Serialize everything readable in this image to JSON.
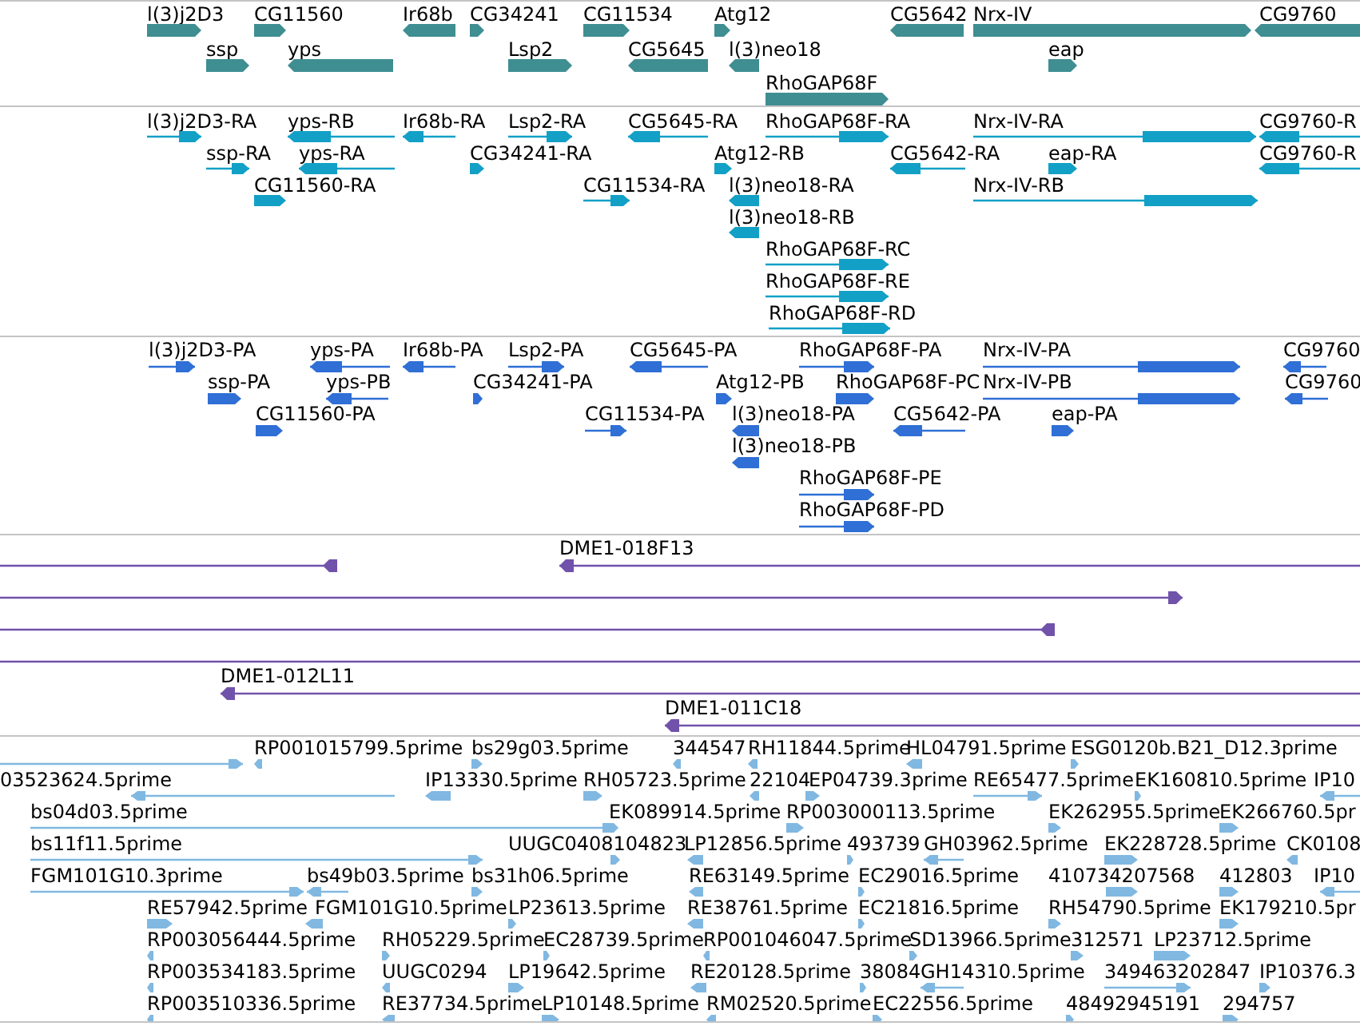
{
  "tracks": [
    {
      "kind": "gene",
      "rows": [
        {
          "features": [
            {
              "label": "l(3)j2D3",
              "reverse": false
            },
            {
              "label": "CG11560",
              "reverse": false
            },
            {
              "label": "Ir68b",
              "reverse": true
            },
            {
              "label": "CG34241",
              "reverse": false
            },
            {
              "label": "CG11534",
              "reverse": false
            },
            {
              "label": "Atg12",
              "reverse": false
            },
            {
              "label": "CG5642",
              "reverse": true
            },
            {
              "label": "Nrx-IV",
              "reverse": false
            },
            {
              "label": "CG9760",
              "reverse": true
            }
          ]
        },
        {
          "features": [
            {
              "label": "ssp",
              "reverse": false
            },
            {
              "label": "yps",
              "reverse": true
            },
            {
              "label": "Lsp2",
              "reverse": false
            },
            {
              "label": "CG5645",
              "reverse": true
            },
            {
              "label": "l(3)neo18",
              "reverse": true
            },
            {
              "label": "eap",
              "reverse": false
            }
          ]
        },
        {
          "features": [
            {
              "label": "RhoGAP68F",
              "reverse": false
            }
          ]
        }
      ]
    },
    {
      "kind": "transcript",
      "rows": [
        {
          "features": [
            {
              "label": "l(3)j2D3-RA",
              "reverse": false
            },
            {
              "label": "yps-RB",
              "reverse": true
            },
            {
              "label": "Ir68b-RA",
              "reverse": true
            },
            {
              "label": "Lsp2-RA",
              "reverse": false
            },
            {
              "label": "CG5645-RA",
              "reverse": true
            },
            {
              "label": "RhoGAP68F-RA",
              "reverse": false
            },
            {
              "label": "Nrx-IV-RA",
              "reverse": false
            },
            {
              "label": "CG9760-R",
              "reverse": true
            }
          ]
        },
        {
          "features": [
            {
              "label": "ssp-RA",
              "reverse": false
            },
            {
              "label": "yps-RA",
              "reverse": true
            },
            {
              "label": "CG34241-RA",
              "reverse": false
            },
            {
              "label": "Atg12-RB",
              "reverse": false
            },
            {
              "label": "CG5642-RA",
              "reverse": true
            },
            {
              "label": "eap-RA",
              "reverse": false
            },
            {
              "label": "CG9760-R",
              "reverse": true
            }
          ]
        },
        {
          "features": [
            {
              "label": "CG11560-RA",
              "reverse": false
            },
            {
              "label": "CG11534-RA",
              "reverse": false
            },
            {
              "label": "l(3)neo18-RA",
              "reverse": true
            },
            {
              "label": "Nrx-IV-RB",
              "reverse": false
            }
          ]
        },
        {
          "features": [
            {
              "label": "l(3)neo18-RB",
              "reverse": true
            }
          ]
        },
        {
          "features": [
            {
              "label": "RhoGAP68F-RC",
              "reverse": false
            }
          ]
        },
        {
          "features": [
            {
              "label": "RhoGAP68F-RE",
              "reverse": false
            }
          ]
        },
        {
          "features": [
            {
              "label": "RhoGAP68F-RD",
              "reverse": false
            }
          ]
        }
      ]
    },
    {
      "kind": "protein",
      "rows": [
        {
          "features": [
            {
              "label": "l(3)j2D3-PA",
              "reverse": false
            },
            {
              "label": "yps-PA",
              "reverse": true
            },
            {
              "label": "Ir68b-PA",
              "reverse": true
            },
            {
              "label": "Lsp2-PA",
              "reverse": false
            },
            {
              "label": "CG5645-PA",
              "reverse": true
            },
            {
              "label": "RhoGAP68F-PA",
              "reverse": false
            },
            {
              "label": "Nrx-IV-PA",
              "reverse": false
            },
            {
              "label": "CG9760",
              "reverse": true
            }
          ]
        },
        {
          "features": [
            {
              "label": "ssp-PA",
              "reverse": false
            },
            {
              "label": "yps-PB",
              "reverse": true
            },
            {
              "label": "CG34241-PA",
              "reverse": false
            },
            {
              "label": "Atg12-PB",
              "reverse": false
            },
            {
              "label": "RhoGAP68F-PC",
              "reverse": false
            },
            {
              "label": "Nrx-IV-PB",
              "reverse": false
            },
            {
              "label": "CG9760",
              "reverse": true
            }
          ]
        },
        {
          "features": [
            {
              "label": "CG11560-PA",
              "reverse": false
            },
            {
              "label": "CG11534-PA",
              "reverse": false
            },
            {
              "label": "l(3)neo18-PA",
              "reverse": true
            },
            {
              "label": "CG5642-PA",
              "reverse": true
            },
            {
              "label": "eap-PA",
              "reverse": false
            }
          ]
        },
        {
          "features": [
            {
              "label": "l(3)neo18-PB",
              "reverse": true
            }
          ]
        },
        {
          "features": [
            {
              "label": "RhoGAP68F-PE",
              "reverse": false
            }
          ]
        },
        {
          "features": [
            {
              "label": "RhoGAP68F-PD",
              "reverse": false
            }
          ]
        }
      ]
    },
    {
      "kind": "clone",
      "rows": [
        {
          "features": [
            {
              "reverse": true
            },
            {
              "label": "DME1-018F13",
              "reverse": true
            }
          ]
        },
        {
          "features": [
            {
              "reverse": false
            }
          ]
        },
        {
          "features": [
            {
              "reverse": true
            }
          ]
        },
        {
          "features": [
            {
              "truncated": true
            }
          ]
        },
        {
          "features": [
            {
              "label": "DME1-012L11",
              "reverse": true
            }
          ]
        },
        {
          "features": [
            {
              "label": "DME1-011C18",
              "reverse": true
            }
          ]
        }
      ]
    },
    {
      "kind": "est",
      "rows": [
        {
          "features": [
            {
              "reverse": false
            },
            {
              "label": "RP001015799.5prime",
              "reverse": true
            },
            {
              "label": "bs29g03.5prime",
              "reverse": false
            },
            {
              "label": "344547",
              "reverse": true
            },
            {
              "label": "RH11844.5prime",
              "reverse": true
            },
            {
              "label": "HL04791.5prime",
              "reverse": true
            },
            {
              "label": "ESG0120b.B21_D12.3prime",
              "reverse": false
            }
          ]
        },
        {
          "features": [
            {
              "label": "03523624.5prime",
              "reverse": true
            },
            {
              "label": "IP13330.5prime",
              "reverse": true
            },
            {
              "label": "RH05723.5prime",
              "reverse": false
            },
            {
              "label": "22104",
              "reverse": true
            },
            {
              "label": "EP04739.3prime",
              "reverse": false
            },
            {
              "label": "RE65477.5prime",
              "reverse": false
            },
            {
              "label": "EK160810.5prime",
              "reverse": false
            },
            {
              "label": "IP10",
              "reverse": true
            }
          ]
        },
        {
          "features": [
            {
              "label": "bs04d03.5prime",
              "reverse": false
            },
            {
              "label": "EK089914.5prime",
              "reverse": false
            },
            {
              "label": "RP003000113.5prime",
              "reverse": false
            },
            {
              "label": "EK262955.5prime",
              "reverse": false
            },
            {
              "label": "EK266760.5pr",
              "reverse": false
            }
          ]
        },
        {
          "features": [
            {
              "label": "bs11f11.5prime",
              "reverse": false
            },
            {
              "label": "UUGC0408104823",
              "reverse": false
            },
            {
              "label": "LP12856.5prime",
              "reverse": true
            },
            {
              "label": "493739",
              "reverse": false
            },
            {
              "label": "GH03962.5prime",
              "reverse": true
            },
            {
              "label": "EK228728.5prime",
              "reverse": false
            },
            {
              "label": "CK0108",
              "reverse": true
            }
          ]
        },
        {
          "features": [
            {
              "label": "FGM101G10.3prime",
              "reverse": false
            },
            {
              "label": "bs49b03.5prime",
              "reverse": true
            },
            {
              "label": "bs31h06.5prime",
              "reverse": false
            },
            {
              "label": "RE63149.5prime",
              "reverse": true
            },
            {
              "label": "EC29016.5prime",
              "reverse": false
            },
            {
              "label": "410734207568",
              "reverse": false
            },
            {
              "label": "412803",
              "reverse": false
            },
            {
              "label": "IP10",
              "reverse": true
            }
          ]
        },
        {
          "features": [
            {
              "label": "RE57942.5prime",
              "reverse": false
            },
            {
              "label": "FGM101G10.5prime",
              "reverse": true
            },
            {
              "label": "LP23613.5prime",
              "reverse": false
            },
            {
              "label": "RE38761.5prime",
              "reverse": true
            },
            {
              "label": "EC21816.5prime",
              "reverse": false
            },
            {
              "label": "RH54790.5prime",
              "reverse": false
            },
            {
              "label": "EK179210.5pr",
              "reverse": false
            }
          ]
        },
        {
          "features": [
            {
              "label": "RP003056444.5prime",
              "reverse": true
            },
            {
              "label": "RH05229.5prime",
              "reverse": false
            },
            {
              "label": "EC28739.5prime",
              "reverse": false
            },
            {
              "label": "RP001046047.5prime",
              "reverse": true
            },
            {
              "label": "SD13966.5prime",
              "reverse": false
            },
            {
              "label": "312571",
              "reverse": false
            },
            {
              "label": "LP23712.5prime",
              "reverse": false
            }
          ]
        },
        {
          "features": [
            {
              "label": "RP003534183.5prime",
              "reverse": true
            },
            {
              "label": "UUGC0294",
              "reverse": true
            },
            {
              "label": "LP19642.5prime",
              "reverse": false
            },
            {
              "label": "RE20128.5prime",
              "reverse": true
            },
            {
              "label": "38084",
              "reverse": false
            },
            {
              "label": "GH14310.5prime",
              "reverse": true
            },
            {
              "label": "349463202847",
              "reverse": false
            },
            {
              "label": "IP10376.3",
              "reverse": false
            }
          ]
        },
        {
          "features": [
            {
              "label": "RP003510336.5prime",
              "reverse": true
            },
            {
              "label": "RE37734.5prime",
              "reverse": true
            },
            {
              "label": "LP10148.5prime",
              "reverse": false
            },
            {
              "label": "RM02520.5prime",
              "reverse": true
            },
            {
              "label": "EC22556.5prime",
              "reverse": false
            },
            {
              "label": "48492945191",
              "reverse": false
            },
            {
              "label": "294757",
              "reverse": false
            }
          ]
        }
      ]
    }
  ]
}
